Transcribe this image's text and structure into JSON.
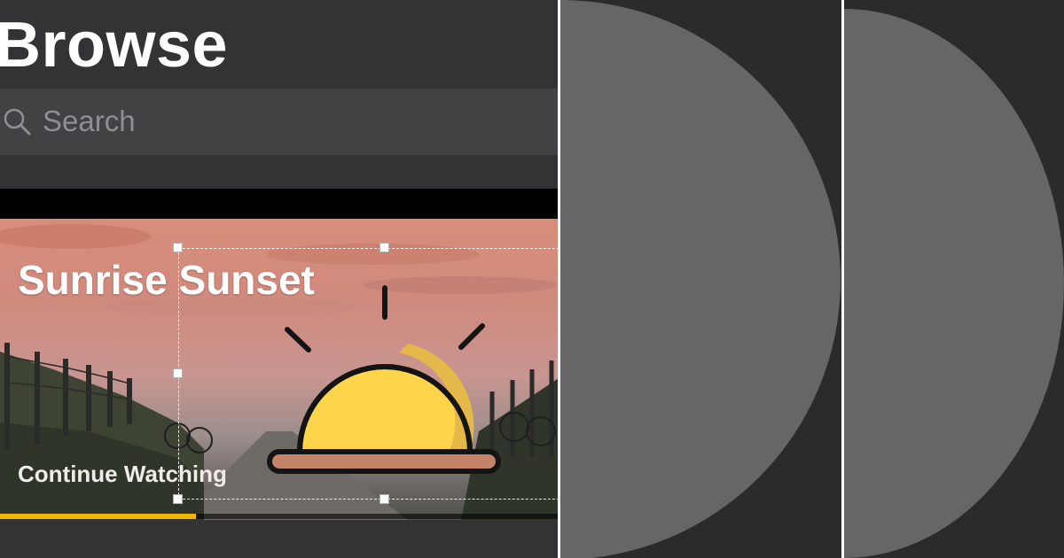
{
  "header": {
    "title": "Browse"
  },
  "search": {
    "placeholder": "Search",
    "icon": "magnifying-glass"
  },
  "hero": {
    "title": "Sunrise Sunset",
    "action_label": "Continue Watching",
    "progress": 0.35,
    "icon": "sunrise-sunset"
  },
  "colors": {
    "background": "#333335",
    "search_background": "#424244",
    "accent": "#f2b500",
    "sun_fill": "#fdd44a",
    "sun_shade": "#e4b94a",
    "horizon": "#c3846a",
    "shape_gray": "#666666"
  }
}
